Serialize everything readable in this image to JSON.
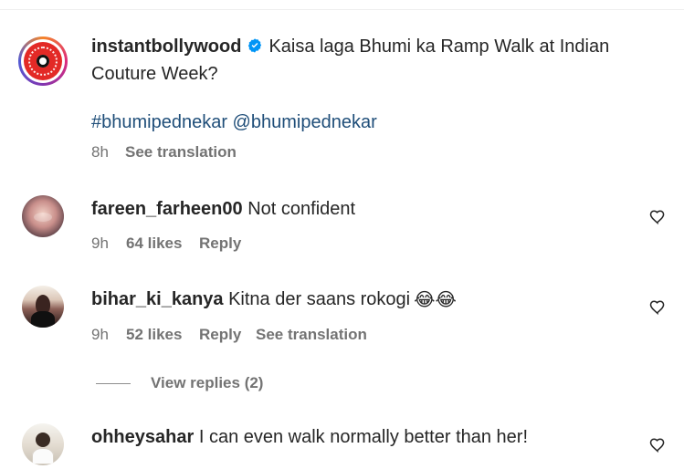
{
  "post": {
    "username": "instantbollywood",
    "caption_line1": "Kaisa laga Bhumi ka Ramp Walk at Indian",
    "caption_line2": "Couture Week?",
    "hashtags": "#bhumipednekar @bhumipednekar",
    "time": "8h",
    "translation": "See translation",
    "avatar_icon": "instant-bollywood-logo"
  },
  "comments": [
    {
      "username": "fareen_farheen00",
      "text": "Not confident",
      "time": "9h",
      "likes": "64 likes",
      "reply": "Reply",
      "avatar_icon": "profile-photo"
    },
    {
      "username": "bihar_ki_kanya",
      "text": "Kitna der saans rokogi",
      "emoji": "😂😂",
      "time": "9h",
      "likes": "52 likes",
      "reply": "Reply",
      "translation": "See translation",
      "view_replies": "View replies (2)",
      "avatar_icon": "profile-photo"
    },
    {
      "username": "ohheysahar",
      "text": "I can even walk normally better than her!",
      "avatar_icon": "profile-photo"
    }
  ],
  "icons": {
    "verified": "verified-badge-icon",
    "heart": "heart-icon"
  },
  "colors": {
    "verified_blue": "#0095f6",
    "hashtag_blue": "#1f4e79",
    "muted_text": "#737373"
  }
}
